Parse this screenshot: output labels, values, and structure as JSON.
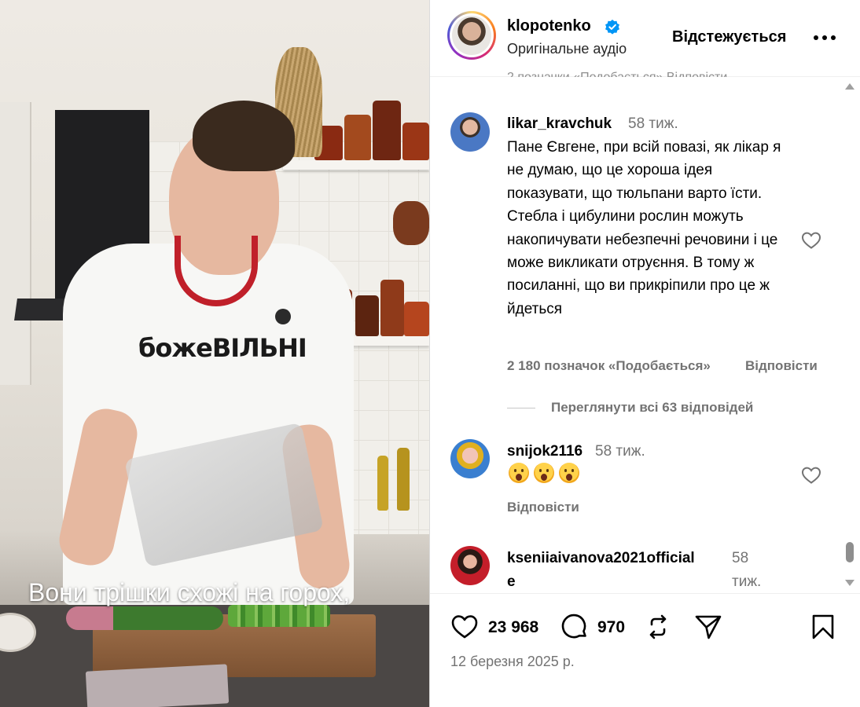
{
  "video": {
    "subtitle": "Вони трішки схожі на горох,",
    "shirt_print": "божеВІЛЬНІ"
  },
  "post": {
    "author": "klopotenko",
    "verified": true,
    "audio": "Оригінальне аудіо",
    "follow_label": "Відстежується",
    "more_icon": "more-horizontal-icon",
    "previous_comment_meta_partial": "2 позначки «Подобається»    Відповісти"
  },
  "comments": [
    {
      "user": "likar_kravchuk",
      "time": "58 тиж.",
      "text": "Пане Євгене, при всій повазі, як лікар я не думаю, що це хороша ідея показувати, що тюльпани варто їсти. Стебла і цибулини рослин можуть накопичувати небезпечні речовини і це може викликати отруєння. В тому ж посиланні, що ви прикріпили про це ж йдеться",
      "likes": "2 180 позначок «Подобається»",
      "reply": "Відповісти",
      "view_replies": "Переглянути всі 63 відповідей"
    },
    {
      "user": "snijok2116",
      "time": "58 тиж.",
      "emojis": [
        "astonished-face",
        "astonished-face",
        "astonished-face"
      ],
      "reply": "Відповісти"
    },
    {
      "user_line1": "kseniiaivanova2021official",
      "user_line2": "e",
      "time_line1": "58",
      "time_line2": "тиж."
    }
  ],
  "actions": {
    "likes": "23 968",
    "comments": "970",
    "date": "12 березня 2025 р."
  },
  "colors": {
    "verified_blue": "#0095f6",
    "secondary_text": "#737373",
    "divider": "#efefef"
  }
}
